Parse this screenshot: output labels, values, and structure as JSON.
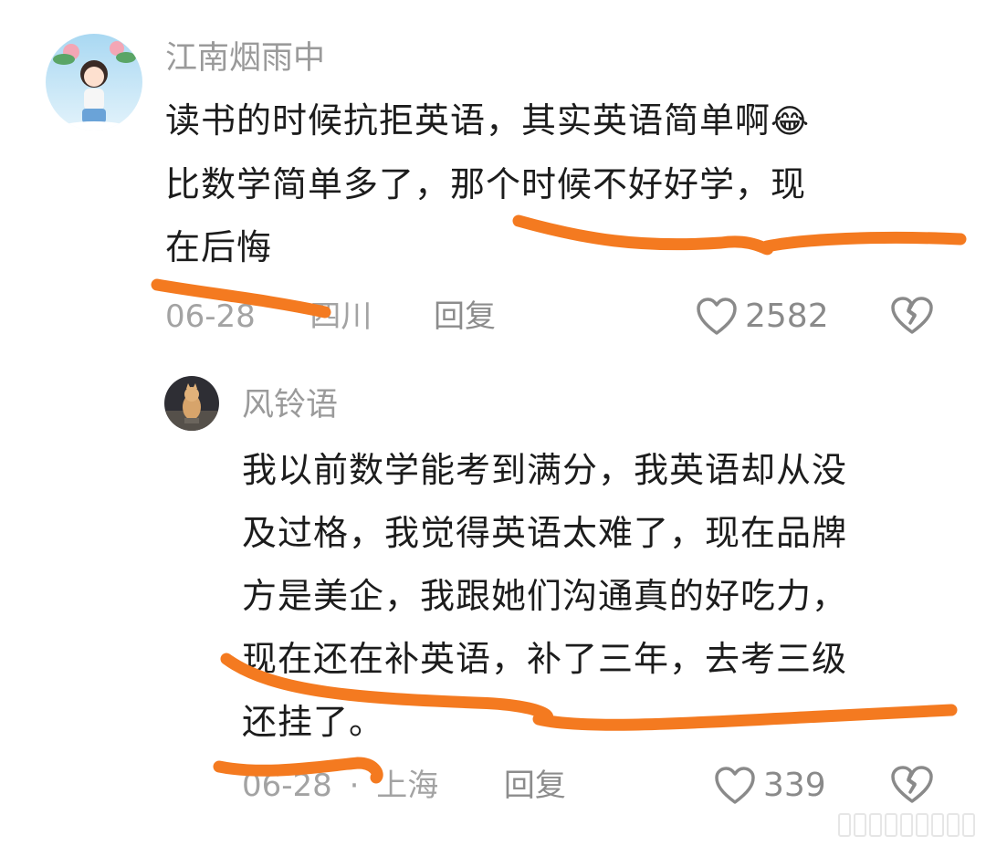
{
  "comments": [
    {
      "username": "江南烟雨中",
      "lines": [
        "读书的时候抗拒英语，其实英语简单啊",
        "比数学简单多了，那个时候不好好学，现",
        "在后悔"
      ],
      "emoji": "😂",
      "date": "06-28",
      "location": "四川",
      "reply_label": "回复",
      "likes": "2582"
    },
    {
      "username": "风铃语",
      "lines": [
        "我以前数学能考到满分，我英语却从没",
        "及过格，我觉得英语太难了，现在品牌",
        "方是美企，我跟她们沟通真的好吃力，",
        "现在还在补英语，补了三年，去考三级",
        "还挂了。"
      ],
      "date": "06-28",
      "separator": "·",
      "location": "上海",
      "reply_label": "回复",
      "likes": "339"
    }
  ],
  "colors": {
    "annotation_stroke": "#f47a20",
    "meta_text": "#a3a3a3",
    "username_text": "#9a9a9a"
  },
  "icons": {
    "like": "heart-outline-icon",
    "dislike": "broken-heart-icon"
  }
}
